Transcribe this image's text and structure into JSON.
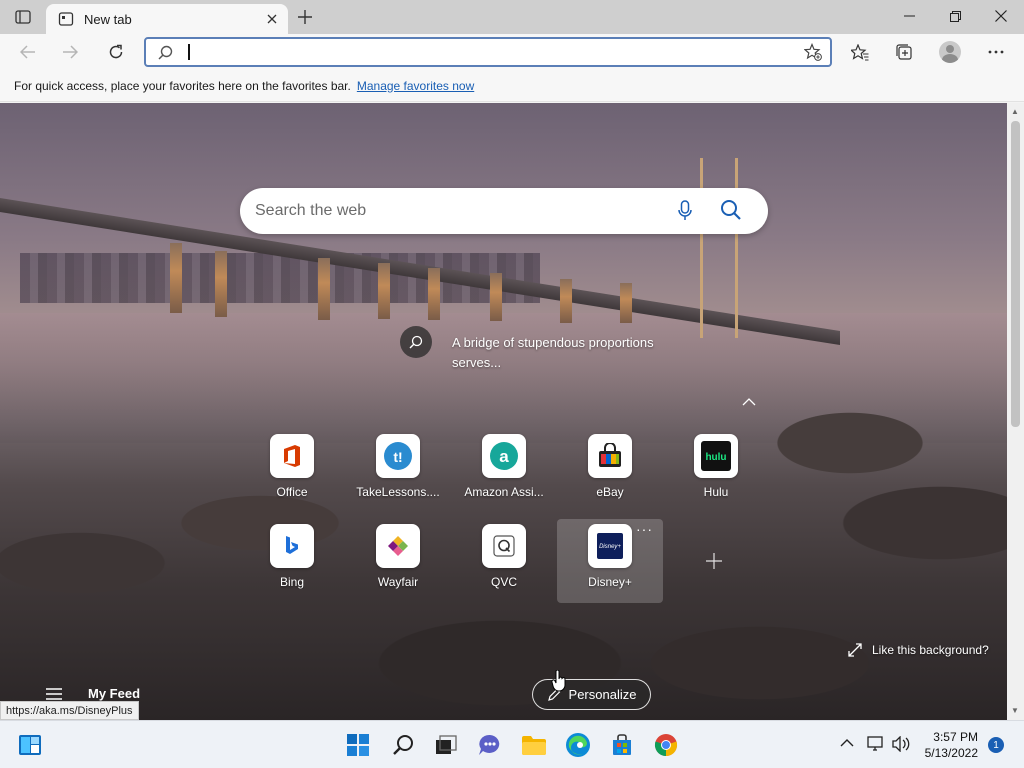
{
  "browser": {
    "tab": {
      "title": "New tab"
    },
    "address_bar": {
      "value": "",
      "placeholder": ""
    },
    "favorites_bar": {
      "message": "For quick access, place your favorites here on the favorites bar.",
      "link": "Manage favorites now"
    }
  },
  "newtab": {
    "search": {
      "placeholder": "Search the web"
    },
    "image_caption": "A bridge of stupendous proportions serves...",
    "quick_links": [
      {
        "label": "Office",
        "icon": "office-icon"
      },
      {
        "label": "TakeLessons....",
        "icon": "takelessons-icon"
      },
      {
        "label": "Amazon Assi...",
        "icon": "amazon-assistant-icon"
      },
      {
        "label": "eBay",
        "icon": "ebay-icon"
      },
      {
        "label": "Hulu",
        "icon": "hulu-icon"
      },
      {
        "label": "Bing",
        "icon": "bing-icon"
      },
      {
        "label": "Wayfair",
        "icon": "wayfair-icon"
      },
      {
        "label": "QVC",
        "icon": "qvc-icon"
      },
      {
        "label": "Disney+",
        "icon": "disney-plus-icon"
      }
    ],
    "like_background": "Like this background?",
    "my_feed": "My Feed",
    "personalize": "Personalize"
  },
  "status_bar": {
    "url": "https://aka.ms/DisneyPlus"
  },
  "taskbar": {
    "time": "3:57 PM",
    "date": "5/13/2022",
    "notification_count": "1"
  },
  "colors": {
    "accent": "#1a5fb4",
    "address_border": "#5b7fb7"
  }
}
